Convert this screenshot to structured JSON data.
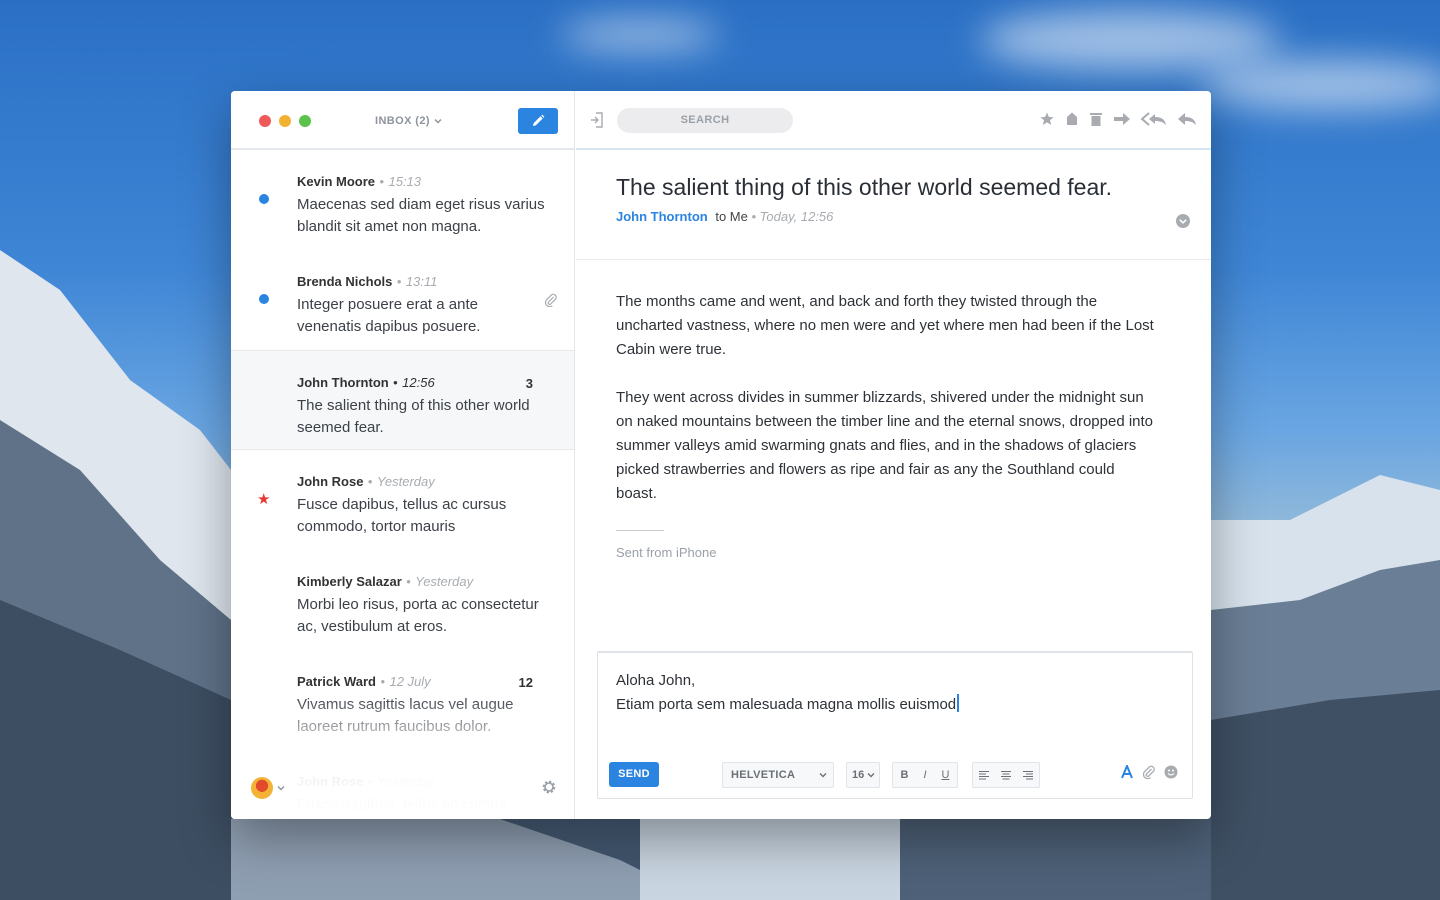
{
  "app": {
    "traffic_lights": [
      "#ee5a5a",
      "#f1b232",
      "#5bc24b"
    ],
    "mailbox": "INBOX (2)",
    "accent": "#2a84e0"
  },
  "toolbar": {
    "search_label": "SEARCH"
  },
  "messages": [
    {
      "from": "Kevin Moore",
      "time": "15:13",
      "preview": "Maecenas sed diam eget risus varius blandit sit amet non magna.",
      "unread": true
    },
    {
      "from": "Brenda Nichols",
      "time": "13:11",
      "preview": "Integer posuere erat a ante venenatis dapibus posuere.",
      "unread": true,
      "attachment": true
    },
    {
      "from": "John Thornton",
      "time": "12:56",
      "preview": "The salient thing of this other world seemed fear.",
      "count": "3",
      "selected": true
    },
    {
      "from": "John Rose",
      "time": "Yesterday",
      "preview": "Fusce dapibus, tellus ac cursus commodo, tortor mauris",
      "starred": true
    },
    {
      "from": "Kimberly Salazar",
      "time": "Yesterday",
      "preview": "Morbi leo risus, porta ac consectetur ac, vestibulum at eros."
    },
    {
      "from": "Patrick Ward",
      "time": "12 July",
      "preview": "Vivamus sagittis lacus vel augue laoreet rutrum faucibus dolor.",
      "count": "12"
    },
    {
      "from": "John Rose",
      "time": "Yesterday",
      "preview": "Fusce dapibus, tellus ac cursus commodo, tortor mauris"
    }
  ],
  "email": {
    "subject": "The salient thing of this other world seemed fear.",
    "sender": "John Thornton",
    "recipient": "to Me",
    "date": "Today, 12:56",
    "paragraphs": [
      "The months came and went, and back and forth they twisted through the uncharted vastness, where no men were and yet where men had been if the Lost Cabin were true.",
      "They went across divides in summer blizzards, shivered under the midnight sun on naked mountains between the timber line and the eternal snows, dropped into summer valleys amid swarming gnats and flies, and in the shadows of glaciers picked strawberries and flowers as ripe and fair as any the Southland could boast."
    ],
    "signature": "Sent from iPhone"
  },
  "reply": {
    "line1": "Aloha John,",
    "line2": "Etiam porta sem malesuada magna mollis euismod",
    "send_label": "SEND",
    "font": "HELVETICA",
    "size": "16",
    "bold": "B",
    "italic": "I",
    "underline": "U"
  }
}
